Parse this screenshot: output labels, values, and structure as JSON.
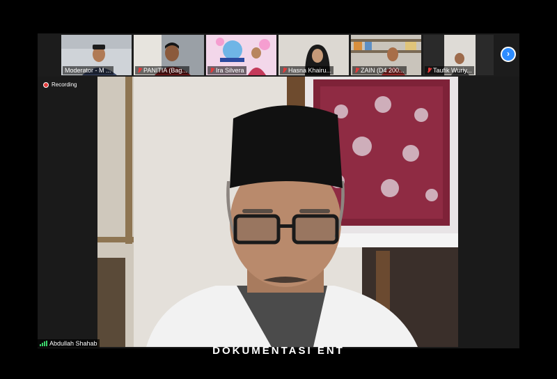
{
  "meeting": {
    "recording_label": "Recording",
    "caption": "DOKUMENTASI ENT",
    "next_icon": "chevron-right-icon"
  },
  "participants": [
    {
      "name": "Moderator - M ..."
    },
    {
      "name": "PANITIA (Bag..."
    },
    {
      "name": "Ira Silvera"
    },
    {
      "name": "Hasna Khairu..."
    },
    {
      "name": "ZAIN (D4 200..."
    },
    {
      "name": "Taufik Wuriy..."
    }
  ],
  "active_speaker": {
    "name": "Abdullah Shahab"
  },
  "colors": {
    "zoom_blue": "#2d8cff",
    "muted_red": "#e23b3b"
  }
}
